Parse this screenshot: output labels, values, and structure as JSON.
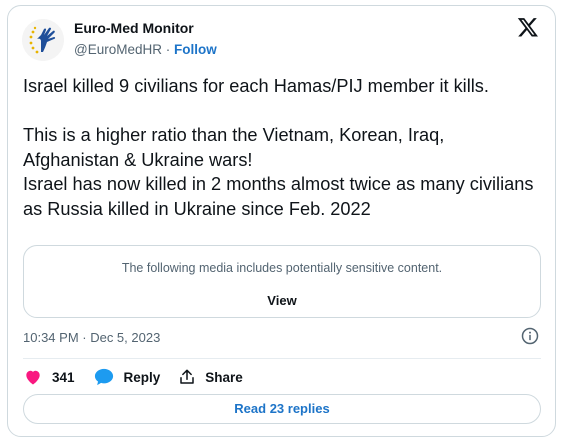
{
  "author": {
    "name": "Euro-Med Monitor",
    "handle": "@EuroMedHR",
    "separator": " · ",
    "follow_label": "Follow"
  },
  "tweet": {
    "text": "Israel killed 9 civilians for each Hamas/PIJ member it kills.\n\nThis is a higher ratio than the Vietnam, Korean, Iraq, Afghanistan & Ukraine wars!\nIsrael has now killed in 2 months almost twice as many civilians as Russia killed in Ukraine since Feb. 2022",
    "timestamp": "10:34 PM · Dec 5, 2023"
  },
  "media": {
    "warning": "The following media includes potentially sensitive content.",
    "view_label": "View"
  },
  "actions": {
    "like_count": "341",
    "reply_label": "Reply",
    "share_label": "Share",
    "read_replies_label": "Read 23 replies"
  },
  "colors": {
    "accent": "#1d74c8",
    "like": "#f91880",
    "text": "#0f1419",
    "muted": "#536471",
    "border": "#cfd9de"
  },
  "icons": {
    "brand": "x-logo-icon",
    "like": "heart-icon",
    "reply": "speech-bubble-icon",
    "share": "share-upload-icon",
    "info": "info-icon"
  }
}
